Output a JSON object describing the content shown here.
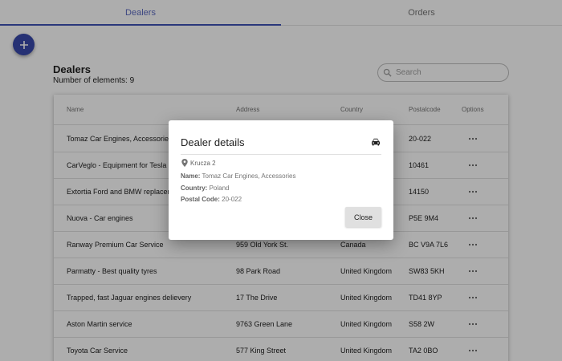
{
  "tabs": [
    {
      "label": "Dealers",
      "active": true
    },
    {
      "label": "Orders",
      "active": false
    }
  ],
  "fab": {
    "icon": "plus-icon"
  },
  "list": {
    "title": "Dealers",
    "count_text": "Number of elements: 9"
  },
  "search": {
    "placeholder": "Search",
    "value": "",
    "icon": "search-icon"
  },
  "table": {
    "columns": {
      "name": "Name",
      "address": "Address",
      "country": "Country",
      "postalcode": "Postalcode",
      "options": "Options"
    },
    "rows": [
      {
        "name": "Tomaz Car Engines, Accessories",
        "address": "Krucza 2",
        "country": "Poland",
        "postalcode": "20-022"
      },
      {
        "name": "CarVeglo - Equipment for Tesla",
        "address": "",
        "country": "",
        "postalcode": "10461"
      },
      {
        "name": "Extortia Ford and BMW replacements",
        "address": "",
        "country": "",
        "postalcode": "14150"
      },
      {
        "name": "Nuova - Car engines",
        "address": "",
        "country": "",
        "postalcode": "P5E 9M4"
      },
      {
        "name": "Ranway Premium Car Service",
        "address": "959 Old York St.",
        "country": "Canada",
        "postalcode": "BC V9A 7L6"
      },
      {
        "name": "Parmatty - Best quality tyres",
        "address": "98 Park Road",
        "country": "United Kingdom",
        "postalcode": "SW83 5KH"
      },
      {
        "name": "Trapped, fast Jaguar engines delievery",
        "address": "17 The Drive",
        "country": "United Kingdom",
        "postalcode": "TD41 8YP"
      },
      {
        "name": "Aston Martin service",
        "address": "9763 Green Lane",
        "country": "United Kingdom",
        "postalcode": "S58 2W"
      },
      {
        "name": "Toyota Car Service",
        "address": "577 King Street",
        "country": "United Kingdom",
        "postalcode": "TA2 0BO"
      }
    ],
    "row_options_icon": "more-horizontal-icon"
  },
  "dialog": {
    "title": "Dealer details",
    "title_icon": "car-icon",
    "address_icon": "map-pin-icon",
    "address": "Krucza 2",
    "name_label": "Name:",
    "name_value": "Tomaz Car Engines, Accessories",
    "country_label": "Country:",
    "country_value": "Poland",
    "postal_label": "Postal Code:",
    "postal_value": "20-022",
    "close_label": "Close"
  },
  "colors": {
    "accent": "#3f51b5",
    "fab": "#3949ab",
    "overlay": "rgba(0,0,0,0.32)"
  }
}
